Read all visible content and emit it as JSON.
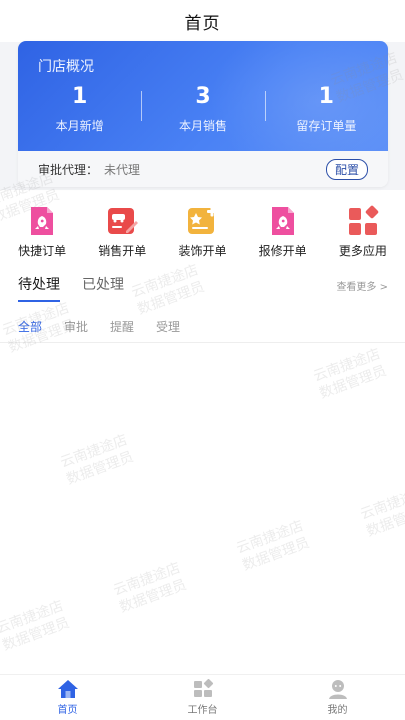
{
  "header": {
    "title": "首页"
  },
  "store_card": {
    "title": "门店概况",
    "stats": [
      {
        "value": "1",
        "label": "本月新增"
      },
      {
        "value": "3",
        "label": "本月销售"
      },
      {
        "value": "1",
        "label": "留存订单量"
      }
    ],
    "approval_label": "审批代理：",
    "approval_value": "未代理",
    "config_label": "配置"
  },
  "quick_menu": {
    "items": [
      {
        "label": "快捷订单",
        "icon": "rocket-document-icon",
        "color": "#ee4f9f"
      },
      {
        "label": "销售开单",
        "icon": "car-edit-icon",
        "color": "#e94a4a"
      },
      {
        "label": "装饰开单",
        "icon": "star-plus-icon",
        "color": "#f2b33d"
      },
      {
        "label": "报修开单",
        "icon": "rocket-document-icon",
        "color": "#ee4f9f"
      },
      {
        "label": "更多应用",
        "icon": "grid-apps-icon",
        "color": "#ea5a5a"
      }
    ]
  },
  "tabs": {
    "items": [
      {
        "label": "待处理"
      },
      {
        "label": "已处理"
      }
    ],
    "active": 0,
    "view_more": "查看更多 >"
  },
  "subtabs": {
    "items": [
      {
        "label": "全部"
      },
      {
        "label": "审批"
      },
      {
        "label": "提醒"
      },
      {
        "label": "受理"
      }
    ],
    "active": 0
  },
  "watermark": {
    "line1": "云南捷途店",
    "line2": "数据管理员"
  },
  "bottom_nav": {
    "items": [
      {
        "label": "首页",
        "icon": "home-icon"
      },
      {
        "label": "工作台",
        "icon": "workbench-icon"
      },
      {
        "label": "我的",
        "icon": "profile-icon"
      }
    ],
    "active": 0
  },
  "colors": {
    "primary": "#2f63e4",
    "accent_pink": "#ee4f9f",
    "accent_red": "#e94a4a",
    "accent_yellow": "#f2b33d"
  }
}
